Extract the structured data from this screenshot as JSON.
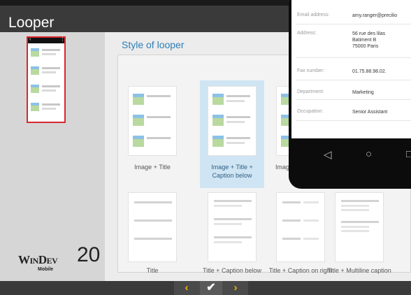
{
  "window": {
    "title": "Looper"
  },
  "main": {
    "section_title": "Style of looper",
    "styles": [
      {
        "label": "Image + Title"
      },
      {
        "label": "Image + Title + Caption below",
        "selected": true
      },
      {
        "label": "Image + Title + Caption"
      },
      {
        "label": "Title"
      },
      {
        "label": "Title + Caption below"
      },
      {
        "label": "Title + Caption on right"
      },
      {
        "label": "Title + Multiline caption"
      }
    ]
  },
  "phone": {
    "fields": [
      {
        "label": "Email address:",
        "value": "amy.ranger@precilio"
      },
      {
        "label": "Address:",
        "value": "56 rue des lilas\nBatiment B\n75000 Paris"
      },
      {
        "label": "Fax number:",
        "value": "01.75.88.98.02."
      },
      {
        "label": "Department:",
        "value": "Marketing"
      },
      {
        "label": "Occupation:",
        "value": "Senior Assistant"
      }
    ]
  },
  "logo": {
    "brand": "WinDev",
    "version": "20",
    "edition": "Mobile"
  },
  "colors": {
    "accent": "#2d7fb8",
    "selection": "#cfe5f3",
    "nav_arrow": "#f2b600",
    "preview_border": "#d9272e"
  },
  "icons": [
    "back-icon",
    "home-icon",
    "recent-apps-icon",
    "chevron-left-icon",
    "checkmark-icon",
    "chevron-right-icon"
  ]
}
